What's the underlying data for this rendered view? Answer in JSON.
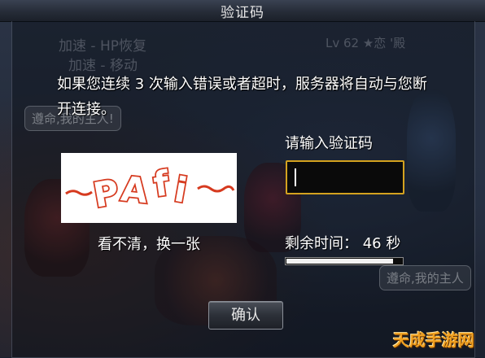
{
  "dialog": {
    "title": "验证码",
    "warning": "如果您连续 3 次输入错误或者超时，服务器将自动与您断开连接。",
    "captcha": {
      "image_text": "~PAfi ~",
      "refresh_label": "看不清，换一张"
    },
    "input": {
      "label": "请输入验证码",
      "value": ""
    },
    "timer": {
      "text": "剩余时间： 46 秒",
      "seconds_remaining": 46,
      "progress_fraction": 0.92
    },
    "confirm_label": "确认",
    "colors": {
      "input_border": "#d4a21f",
      "text": "#ffffff",
      "captcha_ink": "#d63a1f"
    }
  },
  "background": {
    "skill_line_1": "加速 - HP恢复",
    "skill_line_2": "加速 - 移动",
    "player_tag": "Lv 62 ★恋 '殿",
    "chat_bubble_left": "遵命,我的主人!",
    "chat_bubble_right": "遵命,我的主人"
  },
  "watermark": "天成手游网"
}
